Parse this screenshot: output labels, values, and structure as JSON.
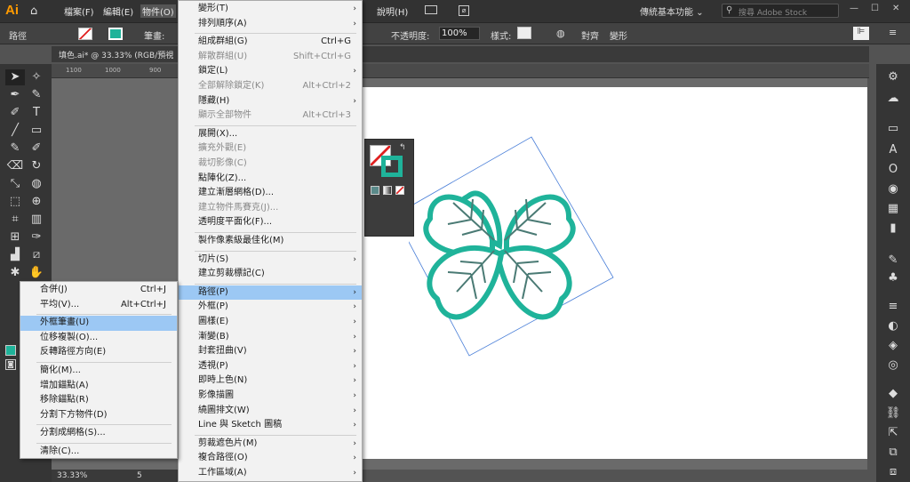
{
  "menubar": {
    "logo": "Ai",
    "items": [
      "檔案(F)",
      "編輯(E)",
      "物件(O)",
      "說明(H)"
    ],
    "workspace": "傳統基本功能",
    "search_placeholder": "搜尋 Adobe Stock"
  },
  "controlbar": {
    "left_label": "路徑",
    "stroke_label": "筆畫:",
    "opacity_label": "不透明度:",
    "opacity_value": "100%",
    "style_label": "樣式:",
    "align_label": "對齊",
    "transform_label": "變形"
  },
  "document": {
    "tab_title": "填色.ai* @ 33.33% (RGB/預視",
    "zoom": "33.33%",
    "page": "5",
    "ruler_ticks": [
      "1100",
      "1000",
      "900"
    ]
  },
  "object_menu": [
    {
      "label": "變形(T)",
      "shortcut": "",
      "submenu": true,
      "disabled": false
    },
    {
      "label": "排列順序(A)",
      "shortcut": "",
      "submenu": true,
      "disabled": false
    },
    {
      "sep": true
    },
    {
      "label": "組成群組(G)",
      "shortcut": "Ctrl+G",
      "submenu": false,
      "disabled": false
    },
    {
      "label": "解散群組(U)",
      "shortcut": "Shift+Ctrl+G",
      "submenu": false,
      "disabled": true
    },
    {
      "label": "鎖定(L)",
      "shortcut": "",
      "submenu": true,
      "disabled": false
    },
    {
      "label": "全部解除鎖定(K)",
      "shortcut": "Alt+Ctrl+2",
      "submenu": false,
      "disabled": true
    },
    {
      "label": "隱藏(H)",
      "shortcut": "",
      "submenu": true,
      "disabled": false
    },
    {
      "label": "顯示全部物件",
      "shortcut": "Alt+Ctrl+3",
      "submenu": false,
      "disabled": true
    },
    {
      "sep": true
    },
    {
      "label": "展開(X)...",
      "shortcut": "",
      "submenu": false,
      "disabled": false
    },
    {
      "label": "擴充外觀(E)",
      "shortcut": "",
      "submenu": false,
      "disabled": true
    },
    {
      "label": "裁切影像(C)",
      "shortcut": "",
      "submenu": false,
      "disabled": true
    },
    {
      "label": "點陣化(Z)...",
      "shortcut": "",
      "submenu": false,
      "disabled": false
    },
    {
      "label": "建立漸層網格(D)...",
      "shortcut": "",
      "submenu": false,
      "disabled": false
    },
    {
      "label": "建立物件馬賽克(J)...",
      "shortcut": "",
      "submenu": false,
      "disabled": true
    },
    {
      "label": "透明度平面化(F)...",
      "shortcut": "",
      "submenu": false,
      "disabled": false
    },
    {
      "sep": true
    },
    {
      "label": "製作像素級最佳化(M)",
      "shortcut": "",
      "submenu": false,
      "disabled": false
    },
    {
      "sep": true
    },
    {
      "label": "切片(S)",
      "shortcut": "",
      "submenu": true,
      "disabled": false
    },
    {
      "label": "建立剪裁標記(C)",
      "shortcut": "",
      "submenu": false,
      "disabled": false
    },
    {
      "sep": true
    },
    {
      "label": "路徑(P)",
      "shortcut": "",
      "submenu": true,
      "disabled": false,
      "highlight": true
    },
    {
      "label": "外框(P)",
      "shortcut": "",
      "submenu": true,
      "disabled": false
    },
    {
      "label": "圖樣(E)",
      "shortcut": "",
      "submenu": true,
      "disabled": false
    },
    {
      "label": "漸變(B)",
      "shortcut": "",
      "submenu": true,
      "disabled": false
    },
    {
      "label": "封套扭曲(V)",
      "shortcut": "",
      "submenu": true,
      "disabled": false
    },
    {
      "label": "透視(P)",
      "shortcut": "",
      "submenu": true,
      "disabled": false
    },
    {
      "label": "即時上色(N)",
      "shortcut": "",
      "submenu": true,
      "disabled": false
    },
    {
      "label": "影像描圖",
      "shortcut": "",
      "submenu": true,
      "disabled": false
    },
    {
      "label": "繞圖排文(W)",
      "shortcut": "",
      "submenu": true,
      "disabled": false
    },
    {
      "label": "Line 與 Sketch 圖稿",
      "shortcut": "",
      "submenu": true,
      "disabled": false
    },
    {
      "sep": true
    },
    {
      "label": "剪裁遮色片(M)",
      "shortcut": "",
      "submenu": true,
      "disabled": false
    },
    {
      "label": "複合路徑(O)",
      "shortcut": "",
      "submenu": true,
      "disabled": false
    },
    {
      "label": "工作區域(A)",
      "shortcut": "",
      "submenu": true,
      "disabled": false
    }
  ],
  "path_submenu": [
    {
      "label": "合併(J)",
      "shortcut": "Ctrl+J"
    },
    {
      "label": "平均(V)...",
      "shortcut": "Alt+Ctrl+J"
    },
    {
      "sep": true
    },
    {
      "label": "外框筆畫(U)",
      "shortcut": "",
      "highlight": true
    },
    {
      "label": "位移複製(O)...",
      "shortcut": ""
    },
    {
      "label": "反轉路徑方向(E)",
      "shortcut": ""
    },
    {
      "sep": true
    },
    {
      "label": "簡化(M)...",
      "shortcut": ""
    },
    {
      "label": "增加錨點(A)",
      "shortcut": ""
    },
    {
      "label": "移除錨點(R)",
      "shortcut": ""
    },
    {
      "label": "分割下方物件(D)",
      "shortcut": ""
    },
    {
      "sep": true
    },
    {
      "label": "分割成網格(S)...",
      "shortcut": ""
    },
    {
      "sep": true
    },
    {
      "label": "清除(C)...",
      "shortcut": ""
    }
  ],
  "colors": {
    "accent": "#1fb39a",
    "highlight": "#9cc8f4",
    "menu_bg": "#f2f2f2"
  }
}
